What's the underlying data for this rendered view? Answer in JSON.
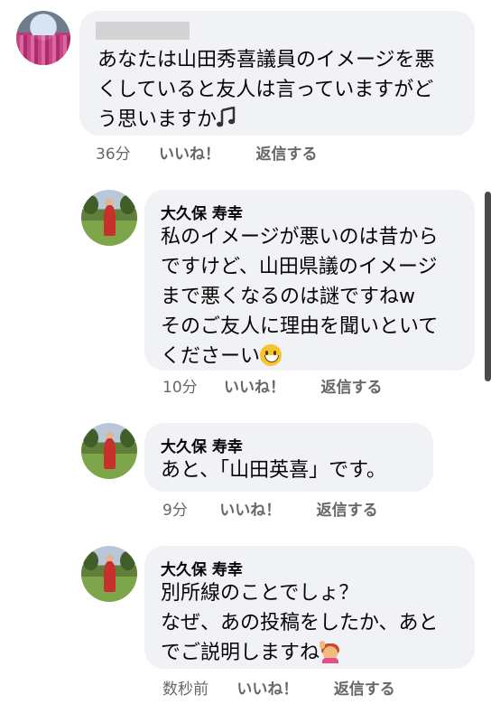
{
  "comments": [
    {
      "name": "",
      "text_lines": [
        "あなたは山田秀喜議員のイメージを悪",
        "くしていると友人は言っていますがど",
        "う思いますか"
      ],
      "time": "36分",
      "like_label": "いいね！",
      "reply_label": "返信する"
    },
    {
      "name": "大久保 寿幸",
      "text_lines": [
        "私のイメージが悪いのは昔から",
        "ですけど、山田県議のイメージ",
        "まで悪くなるのは謎ですねw",
        "そのご友人に理由を聞いといて",
        "くださーい"
      ],
      "time": "10分",
      "like_label": "いいね！",
      "reply_label": "返信する"
    },
    {
      "name": "大久保 寿幸",
      "text_lines": [
        "あと、「山田英喜」です。"
      ],
      "time": "9分",
      "like_label": "いいね！",
      "reply_label": "返信する"
    },
    {
      "name": "大久保 寿幸",
      "text_lines": [
        "別所線のことでしょ？",
        "なぜ、あの投稿をしたか、あと",
        "でご説明しますね"
      ],
      "time": "数秒前",
      "like_label": "いいね！",
      "reply_label": "返信する"
    }
  ],
  "icons": {
    "music": "music-note-icon",
    "smile": "grinning-face-icon",
    "wave": "person-raising-hand-icon"
  }
}
